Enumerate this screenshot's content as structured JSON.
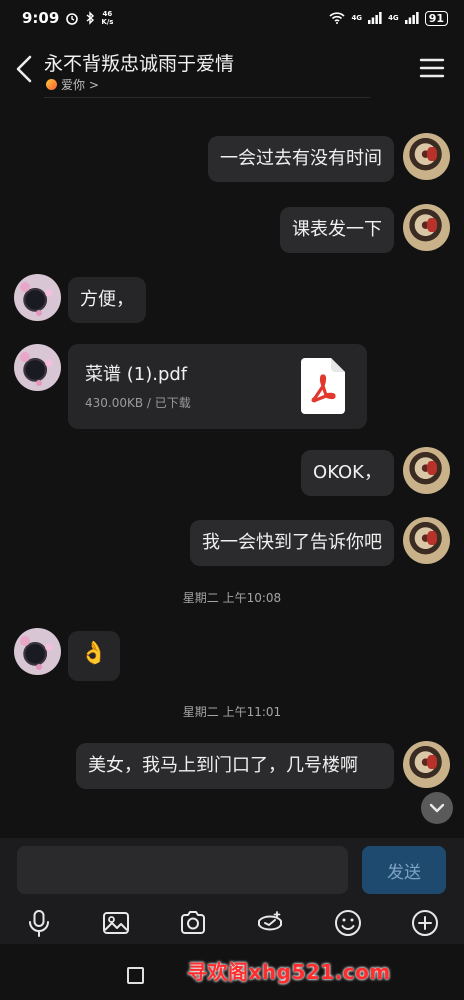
{
  "status_bar": {
    "time": "9:09",
    "net_speed_value": "46",
    "net_speed_unit": "K/s",
    "signal_1": "4G",
    "signal_2": "4G",
    "battery": "91"
  },
  "header": {
    "title": "永不背叛忠诚雨于爱情",
    "subtitle": "爱你 >"
  },
  "messages": [
    {
      "sender": "me",
      "text": "一会过去有没有时间"
    },
    {
      "sender": "me",
      "text": "课表发一下"
    },
    {
      "sender": "her",
      "text": "方便，"
    },
    {
      "sender": "her",
      "type": "file",
      "file_name": "菜谱 (1).pdf",
      "file_meta": "430.00KB / 已下载"
    },
    {
      "sender": "me",
      "text": "OKOK，"
    },
    {
      "sender": "me",
      "text": "我一会快到了告诉你吧"
    },
    {
      "type": "timestamp",
      "text": "星期二 上午10:08"
    },
    {
      "sender": "her",
      "type": "emoji",
      "text": "👌"
    },
    {
      "type": "timestamp",
      "text": "星期二 上午11:01"
    },
    {
      "sender": "me",
      "text": "美女，我马上到门口了，几号楼啊"
    }
  ],
  "input": {
    "value": "",
    "send_label": "发送"
  },
  "toolbar": {
    "icons": [
      "microphone-icon",
      "image-icon",
      "camera-icon",
      "red-packet-icon",
      "emoji-icon",
      "plus-icon"
    ]
  },
  "watermark": "寻欢阁xhg521.com",
  "colors": {
    "background": "#121212",
    "bubble": "#2b2b2d",
    "send_button": "#1e4a70",
    "watermark": "#ff2d2d"
  }
}
